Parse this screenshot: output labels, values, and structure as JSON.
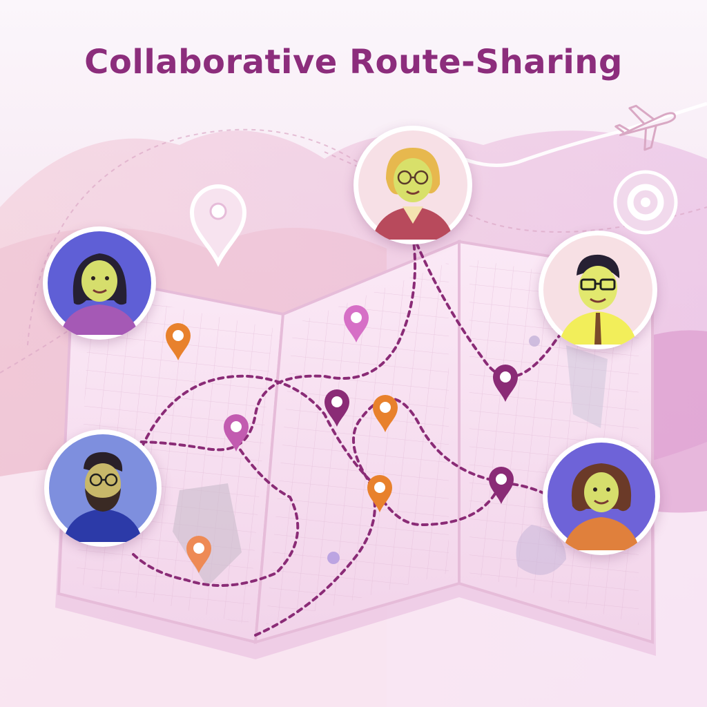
{
  "title": "Collaborative Route-Sharing",
  "colors": {
    "title": "#8c2d7c",
    "route": "#8a2b76",
    "pin_orange": "#e8812c",
    "pin_magenta": "#c25bb0",
    "pin_plum": "#8a2b76",
    "pin_pink": "#d66fc6",
    "map_fill": "#f6dff0",
    "map_border": "#e6bcd9",
    "avatar_ring": "#ffffff"
  },
  "icons": [
    "location-outline-icon",
    "airplane-icon",
    "target-icon"
  ],
  "participants": [
    "avatar-woman-glasses",
    "avatar-woman-dark-hair",
    "avatar-man-glasses",
    "avatar-man-beard",
    "avatar-woman-brown-hair"
  ]
}
